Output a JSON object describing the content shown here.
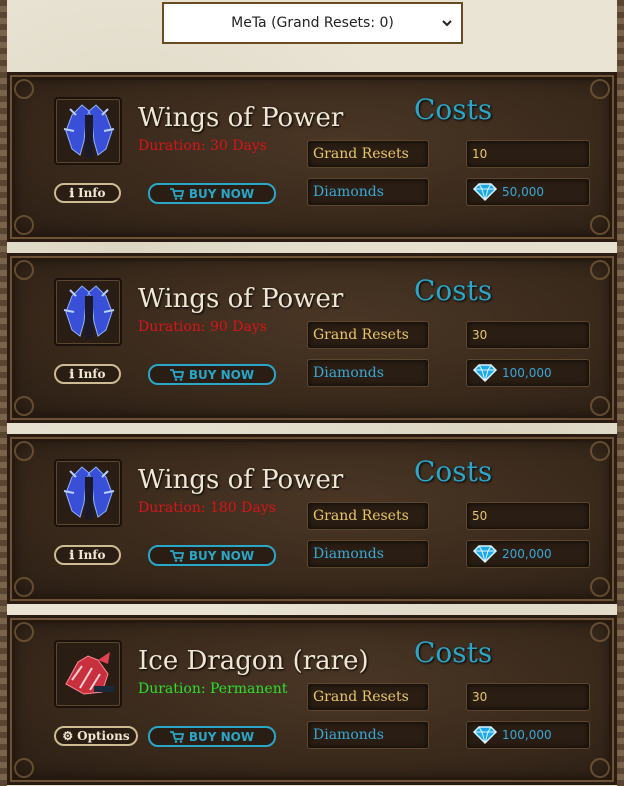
{
  "character_select": {
    "selected": "MeTa (Grand Resets: 0)"
  },
  "costs_heading": "Costs",
  "items": [
    {
      "name": "Wings of Power",
      "duration": "Duration: 30 Days",
      "icon": "wings-icon",
      "info_button": "Info",
      "buy_button": "BUY NOW",
      "costs": [
        {
          "label": "Grand Resets",
          "value": "10"
        },
        {
          "label": "Diamonds",
          "value": "50,000"
        }
      ]
    },
    {
      "name": "Wings of Power",
      "duration": "Duration: 90 Days",
      "icon": "wings-icon",
      "info_button": "Info",
      "buy_button": "BUY NOW",
      "costs": [
        {
          "label": "Grand Resets",
          "value": "30"
        },
        {
          "label": "Diamonds",
          "value": "100,000"
        }
      ]
    },
    {
      "name": "Wings of Power",
      "duration": "Duration: 180 Days",
      "icon": "wings-icon",
      "info_button": "Info",
      "buy_button": "BUY NOW",
      "costs": [
        {
          "label": "Grand Resets",
          "value": "50"
        },
        {
          "label": "Diamonds",
          "value": "200,000"
        }
      ]
    },
    {
      "name": "Ice Dragon (rare)",
      "duration": "Duration: Permanent",
      "icon": "ice-dragon-icon",
      "info_button": "Options",
      "buy_button": "BUY NOW",
      "costs": [
        {
          "label": "Grand Resets",
          "value": "30"
        },
        {
          "label": "Diamonds",
          "value": "100,000"
        }
      ]
    }
  ],
  "colors": {
    "duration_red": "#d8141a",
    "duration_green": "#2be02b",
    "accent_cyan": "#2aa6c8",
    "gold": "#e8c767"
  }
}
